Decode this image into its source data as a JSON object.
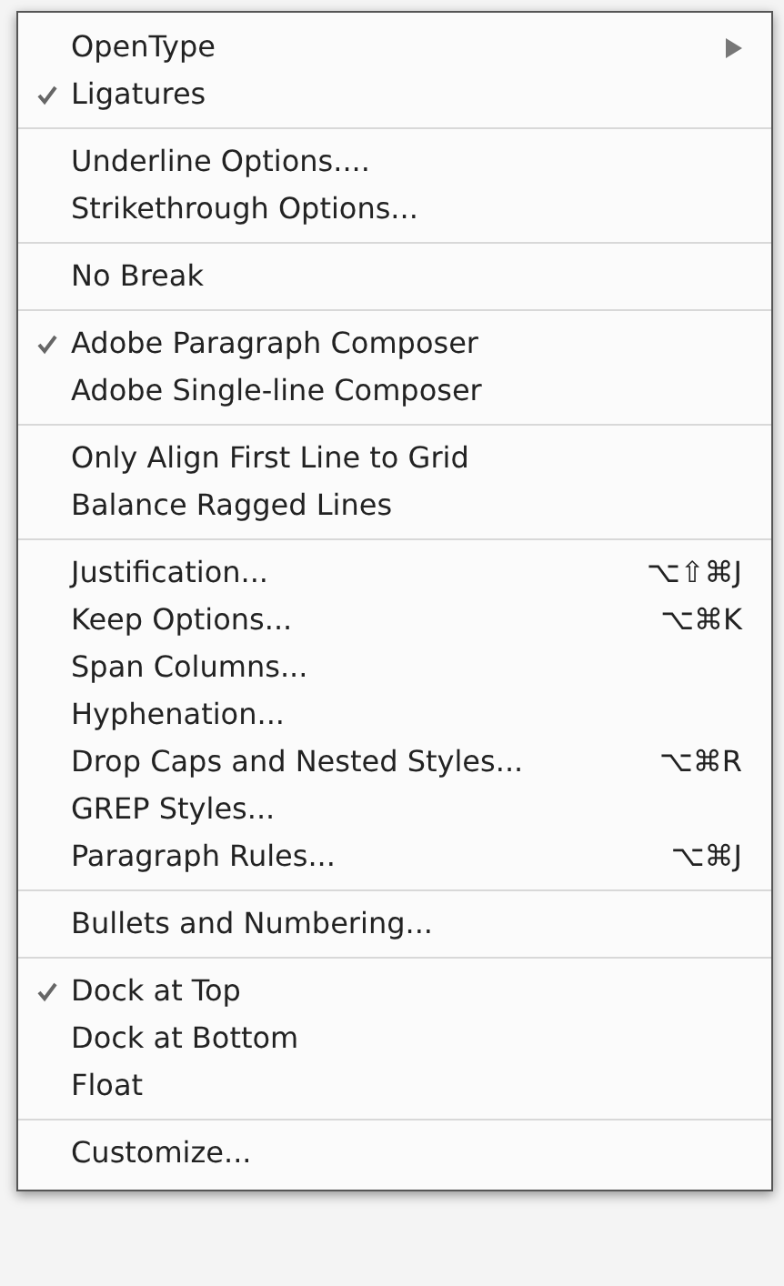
{
  "menu": {
    "groups": [
      {
        "items": [
          {
            "kind": "submenu",
            "label": "OpenType",
            "checked": false
          },
          {
            "kind": "command",
            "label": "Ligatures",
            "checked": true
          }
        ]
      },
      {
        "items": [
          {
            "kind": "command",
            "label": "Underline Options....",
            "checked": false
          },
          {
            "kind": "command",
            "label": "Strikethrough Options...",
            "checked": false
          }
        ]
      },
      {
        "items": [
          {
            "kind": "command",
            "label": "No Break",
            "checked": false
          }
        ]
      },
      {
        "items": [
          {
            "kind": "command",
            "label": "Adobe Paragraph Composer",
            "checked": true
          },
          {
            "kind": "command",
            "label": "Adobe Single-line Composer",
            "checked": false
          }
        ]
      },
      {
        "items": [
          {
            "kind": "command",
            "label": "Only Align First Line to Grid",
            "checked": false
          },
          {
            "kind": "command",
            "label": "Balance Ragged Lines",
            "checked": false
          }
        ]
      },
      {
        "items": [
          {
            "kind": "command",
            "label": "Justification...",
            "checked": false,
            "shortcut": "⌥⇧⌘J"
          },
          {
            "kind": "command",
            "label": "Keep Options...",
            "checked": false,
            "shortcut": "⌥⌘K"
          },
          {
            "kind": "command",
            "label": "Span Columns...",
            "checked": false
          },
          {
            "kind": "command",
            "label": "Hyphenation...",
            "checked": false
          },
          {
            "kind": "command",
            "label": "Drop Caps and Nested Styles...",
            "checked": false,
            "shortcut": "⌥⌘R"
          },
          {
            "kind": "command",
            "label": "GREP Styles...",
            "checked": false
          },
          {
            "kind": "command",
            "label": "Paragraph Rules...",
            "checked": false,
            "shortcut": "⌥⌘J"
          }
        ]
      },
      {
        "items": [
          {
            "kind": "command",
            "label": "Bullets and Numbering...",
            "checked": false
          }
        ]
      },
      {
        "items": [
          {
            "kind": "command",
            "label": "Dock at Top",
            "checked": true
          },
          {
            "kind": "command",
            "label": "Dock at Bottom",
            "checked": false
          },
          {
            "kind": "command",
            "label": "Float",
            "checked": false
          }
        ]
      },
      {
        "items": [
          {
            "kind": "command",
            "label": "Customize...",
            "checked": false
          }
        ]
      }
    ]
  }
}
